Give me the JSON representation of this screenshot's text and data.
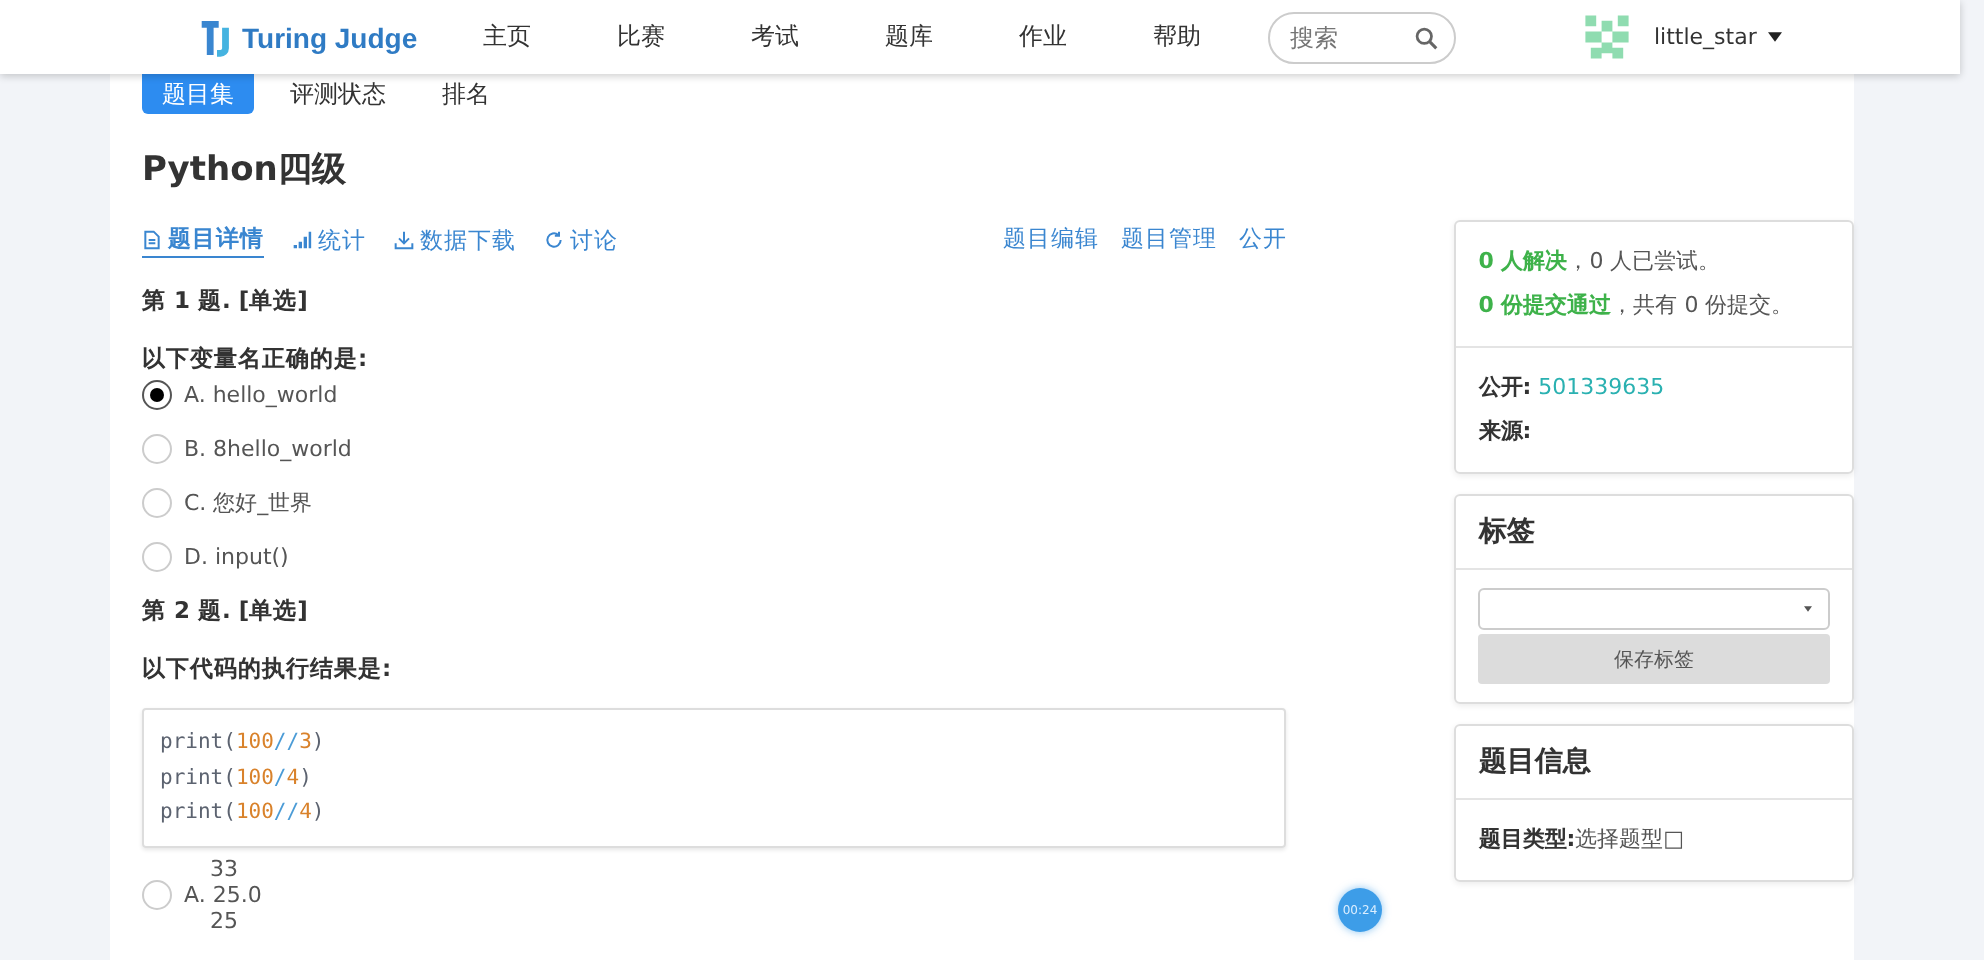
{
  "navbar": {
    "logo": "Turing Judge",
    "menu": [
      {
        "label": "主页"
      },
      {
        "label": "比赛"
      },
      {
        "label": "考试"
      },
      {
        "label": "题库"
      },
      {
        "label": "作业"
      },
      {
        "label": "帮助"
      }
    ],
    "search": {
      "placeholder": "搜索"
    },
    "user": "little_star"
  },
  "top_tabs": [
    {
      "label": "题目集",
      "selected": true
    },
    {
      "label": "评测状态",
      "selected": false
    },
    {
      "label": "排名",
      "selected": false
    }
  ],
  "title": "Python四级",
  "subnav": {
    "left": [
      {
        "label": "题目详情",
        "kind": "doc",
        "selected": true
      },
      {
        "label": "统计",
        "kind": "bars",
        "selected": false
      },
      {
        "label": "数据下载",
        "kind": "download",
        "selected": false
      },
      {
        "label": "讨论",
        "kind": "refresh",
        "selected": false
      }
    ],
    "right": [
      {
        "label": "题目编辑"
      },
      {
        "label": "题目管理"
      },
      {
        "label": "公开"
      }
    ]
  },
  "questions": [
    {
      "header": "第 1 题. [单选]",
      "prompt": "以下变量名正确的是:",
      "options": [
        {
          "letter": "A.",
          "lines": [
            "hello_world"
          ],
          "selected": true
        },
        {
          "letter": "B.",
          "lines": [
            "8hello_world"
          ],
          "selected": false
        },
        {
          "letter": "C.",
          "lines": [
            "您好_世界"
          ],
          "selected": false
        },
        {
          "letter": "D.",
          "lines": [
            "input()"
          ],
          "selected": false
        }
      ]
    },
    {
      "header": "第 2 题. [单选]",
      "prompt": "以下代码的执行结果是:",
      "code": [
        [
          {
            "t": "print(",
            "kind": "fn"
          },
          {
            "t": "100",
            "kind": "num"
          },
          {
            "t": "//",
            "kind": "op"
          },
          {
            "t": "3",
            "kind": "num"
          },
          {
            "t": ")",
            "kind": "fn"
          }
        ],
        [
          {
            "t": "print(",
            "kind": "fn"
          },
          {
            "t": "100",
            "kind": "num"
          },
          {
            "t": "/",
            "kind": "op"
          },
          {
            "t": "4",
            "kind": "num"
          },
          {
            "t": ")",
            "kind": "fn"
          }
        ],
        [
          {
            "t": "print(",
            "kind": "fn"
          },
          {
            "t": "100",
            "kind": "num"
          },
          {
            "t": "//",
            "kind": "op"
          },
          {
            "t": "4",
            "kind": "num"
          },
          {
            "t": ")",
            "kind": "fn"
          }
        ]
      ],
      "options": [
        {
          "letter": "A.",
          "lines": [
            "33",
            "25.0",
            "25"
          ],
          "selected": false
        }
      ]
    }
  ],
  "stats": {
    "line1": {
      "hi": "0 人解决",
      "rest": "，0 人已尝试。"
    },
    "line2": {
      "hi": "0 份提交通过",
      "rest": "，共有 0 份提交。"
    },
    "public_label": "公开:",
    "public_value": "501339635",
    "source_label": "来源:"
  },
  "tags_panel": {
    "title": "标签",
    "button": "保存标签"
  },
  "info_panel": {
    "title": "题目信息",
    "type_label": "题目类型:",
    "type_value": "选择题型□"
  },
  "timer": "00:24"
}
